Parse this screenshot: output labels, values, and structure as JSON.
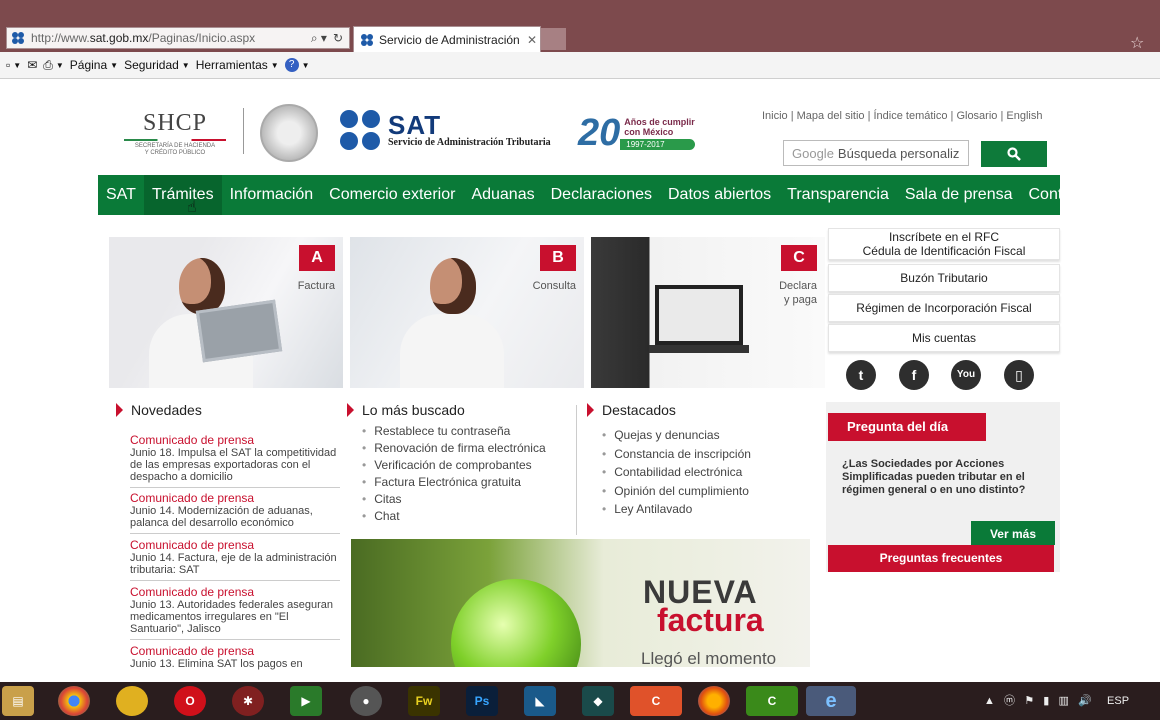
{
  "browser": {
    "url_prefix": "http://www.",
    "url_host": "sat.gob.mx",
    "url_path": "/Paginas/Inicio.aspx",
    "tab_title": "Servicio de Administración ...",
    "command_bar": [
      "Página",
      "Seguridad",
      "Herramientas"
    ]
  },
  "header": {
    "shcp": "SHCP",
    "shcp_sub_1": "SECRETARÍA DE HACIENDA",
    "shcp_sub_2": "Y CRÉDITO PÚBLICO",
    "sat": "SAT",
    "sat_name": "Servicio de Administración Tributaria",
    "anniv_num": "20",
    "anniv_line1": "Años de cumplir",
    "anniv_line2": "con México",
    "anniv_years": "1997-2017",
    "top_links": "Inicio | Mapa del sitio | Índice temático | Glosario | English",
    "search_google": "Google",
    "search_placeholder": "Búsqueda personaliz"
  },
  "nav": [
    "SAT",
    "Trámites",
    "Información",
    "Comercio exterior",
    "Aduanas",
    "Declaraciones",
    "Datos abiertos",
    "Transparencia",
    "Sala de prensa",
    "Contacto"
  ],
  "hero": [
    {
      "badge": "A",
      "caption": "Factura"
    },
    {
      "badge": "B",
      "caption": "Consulta"
    },
    {
      "badge": "C",
      "caption_1": "Declara",
      "caption_2": "y paga"
    }
  ],
  "quick_links": [
    {
      "line1": "Inscríbete en el RFC",
      "line2": "Cédula de Identificación Fiscal"
    },
    {
      "line1": "Buzón Tributario"
    },
    {
      "line1": "Régimen de Incorporación Fiscal"
    },
    {
      "line1": "Mis cuentas"
    }
  ],
  "novedades": {
    "title": "Novedades",
    "items": [
      {
        "kind": "Comunicado de prensa",
        "text": "Junio 18. Impulsa el SAT la competitividad de las empresas exportadoras con el despacho a domicilio"
      },
      {
        "kind": "Comunicado de prensa",
        "text": "Junio 14. Modernización de aduanas, palanca del desarrollo económico"
      },
      {
        "kind": "Comunicado de prensa",
        "text": "Junio 14. Factura, eje de la administración tributaria: SAT"
      },
      {
        "kind": "Comunicado de prensa",
        "text": "Junio 13. Autoridades federales aseguran medicamentos irregulares en \"El Santuario\", Jalisco"
      },
      {
        "kind": "Comunicado de prensa",
        "text": "Junio 13. Elimina SAT los pagos en"
      }
    ]
  },
  "mas_buscado": {
    "title": "Lo más buscado",
    "items": [
      "Restablece tu contraseña",
      "Renovación de firma electrónica",
      "Verificación de comprobantes",
      "Factura Electrónica gratuita",
      "Citas",
      "Chat"
    ]
  },
  "destacados": {
    "title": "Destacados",
    "items": [
      "Quejas y denuncias",
      "Constancia de inscripción",
      "Contabilidad electrónica",
      "Opinión del cumplimiento",
      "Ley Antilavado"
    ]
  },
  "banner": {
    "line1": "NUEVA",
    "line2": "factura",
    "line3": "Llegó el momento"
  },
  "pregunta": {
    "title": "Pregunta del día",
    "text": "¿Las Sociedades por Acciones Simplificadas pueden tributar en el régimen general o en uno distinto?",
    "ver_mas": "Ver más",
    "frecuentes": "Preguntas frecuentes"
  },
  "taskbar": {
    "fw": "Fw",
    "ps": "Ps",
    "lang": "ESP"
  },
  "colors": {
    "green": "#0a7a38",
    "red": "#c8102e",
    "navy": "#123a7a"
  }
}
